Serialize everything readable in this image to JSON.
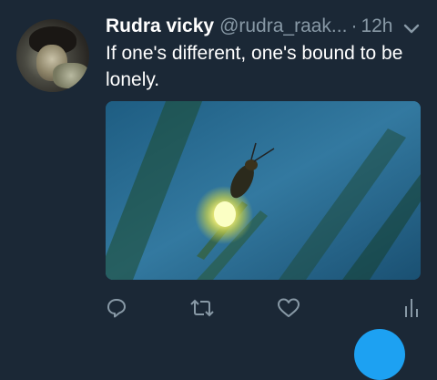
{
  "tweet": {
    "display_name": "Rudra vicky",
    "handle": "@rudra_raak...",
    "separator": "·",
    "timestamp": "12h",
    "text": "If one's different, one's bound to be lonely."
  },
  "media": {
    "description_icon": "firefly-photo"
  },
  "actions": {
    "reply_icon": "reply-icon",
    "retweet_icon": "retweet-icon",
    "like_icon": "heart-icon",
    "analytics_icon": "analytics-icon"
  },
  "colors": {
    "background": "#1b2836",
    "secondary_text": "#8899a6",
    "accent": "#1da1f2"
  }
}
